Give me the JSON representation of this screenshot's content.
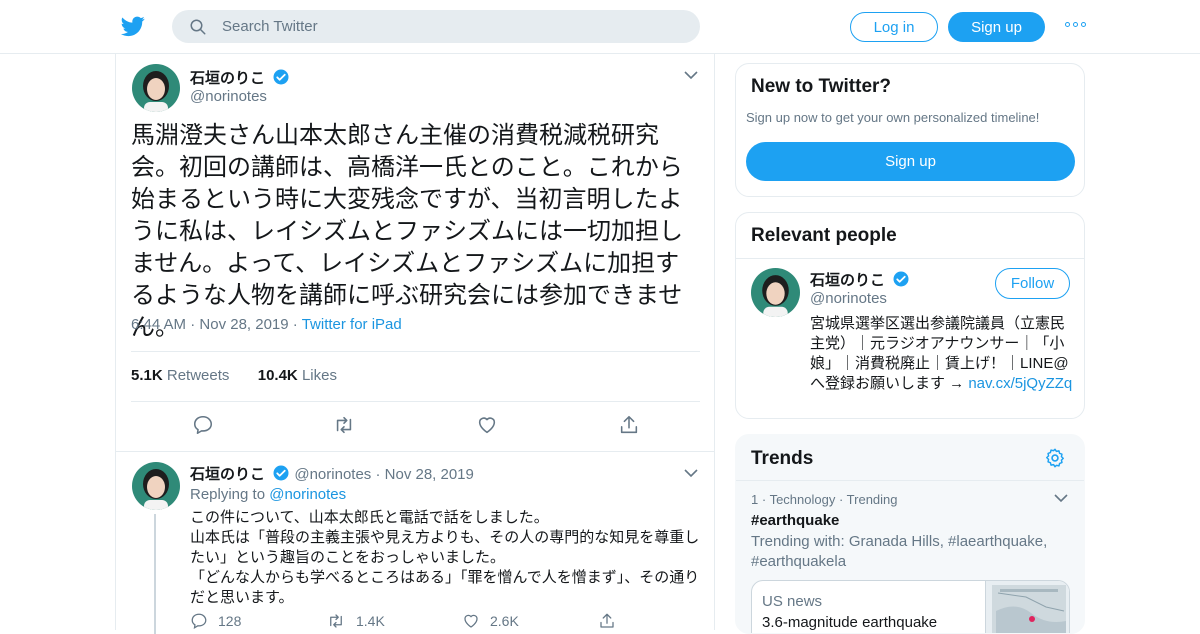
{
  "header": {
    "search_placeholder": "Search Twitter",
    "login_label": "Log in",
    "signup_label": "Sign up"
  },
  "tweet": {
    "author_name": "石垣のりこ",
    "author_handle": "@norinotes",
    "text": "馬淵澄夫さん山本太郎さん主催の消費税減税研究会。初回の講師は、高橋洋一氏とのこと。これから始まるという時に大変残念ですが、当初言明したように私は、レイシズムとファシズムには一切加担しません。よって、レイシズムとファシズムに加担するような人物を講師に呼ぶ研究会には参加できません。",
    "time": "6:44 AM",
    "date": "Nov 28, 2019",
    "source": "Twitter for iPad",
    "retweets_count": "5.1K",
    "retweets_label": "Retweets",
    "likes_count": "10.4K",
    "likes_label": "Likes"
  },
  "reply": {
    "author_name": "石垣のりこ",
    "author_handle": "@norinotes",
    "date": "Nov 28, 2019",
    "replying_to_label": "Replying to",
    "replying_to_handle": "@norinotes",
    "text_lines": [
      "この件について、山本太郎氏と電話で話をしました。",
      "山本氏は「普段の主義主張や見え方よりも、その人の専門的な知見を尊重したい」という趣旨のことをおっしゃいました。",
      "「どんな人からも学べるところはある」「罪を憎んで人を憎まず」、その通りだと思います。"
    ],
    "reply_count": "128",
    "retweet_count": "1.4K",
    "like_count": "2.6K"
  },
  "sidebar": {
    "new_to_twitter": {
      "title": "New to Twitter?",
      "subtitle": "Sign up now to get your own personalized timeline!",
      "signup_label": "Sign up"
    },
    "relevant_people": {
      "title": "Relevant people",
      "name": "石垣のりこ",
      "handle": "@norinotes",
      "follow_label": "Follow",
      "bio": "宮城県選挙区選出参議院議員（立憲民主党）｜元ラジオアナウンサー｜「小娘」｜消費税廃止｜賃上げ！｜LINE@へ登録お願いします →",
      "bio_link": "nav.cx/5jQyZZq"
    },
    "trends": {
      "title": "Trends",
      "rank": "1",
      "category": "Technology",
      "status": "Trending",
      "tag": "#earthquake",
      "trending_with": "Trending with: Granada Hills, #laearthquake, #earthquakela",
      "news_source": "US news",
      "news_headline": "3.6-magnitude earthquake"
    }
  },
  "colors": {
    "brand_blue": "#1da1f2",
    "link_blue": "#1b95e0",
    "secondary_text": "#657786",
    "border": "#e6ecf0"
  },
  "icons": [
    "twitter-bird-icon",
    "search-icon",
    "more-icon",
    "chevron-down-icon",
    "verified-icon",
    "reply-icon",
    "retweet-icon",
    "like-icon",
    "share-icon",
    "gear-icon"
  ]
}
